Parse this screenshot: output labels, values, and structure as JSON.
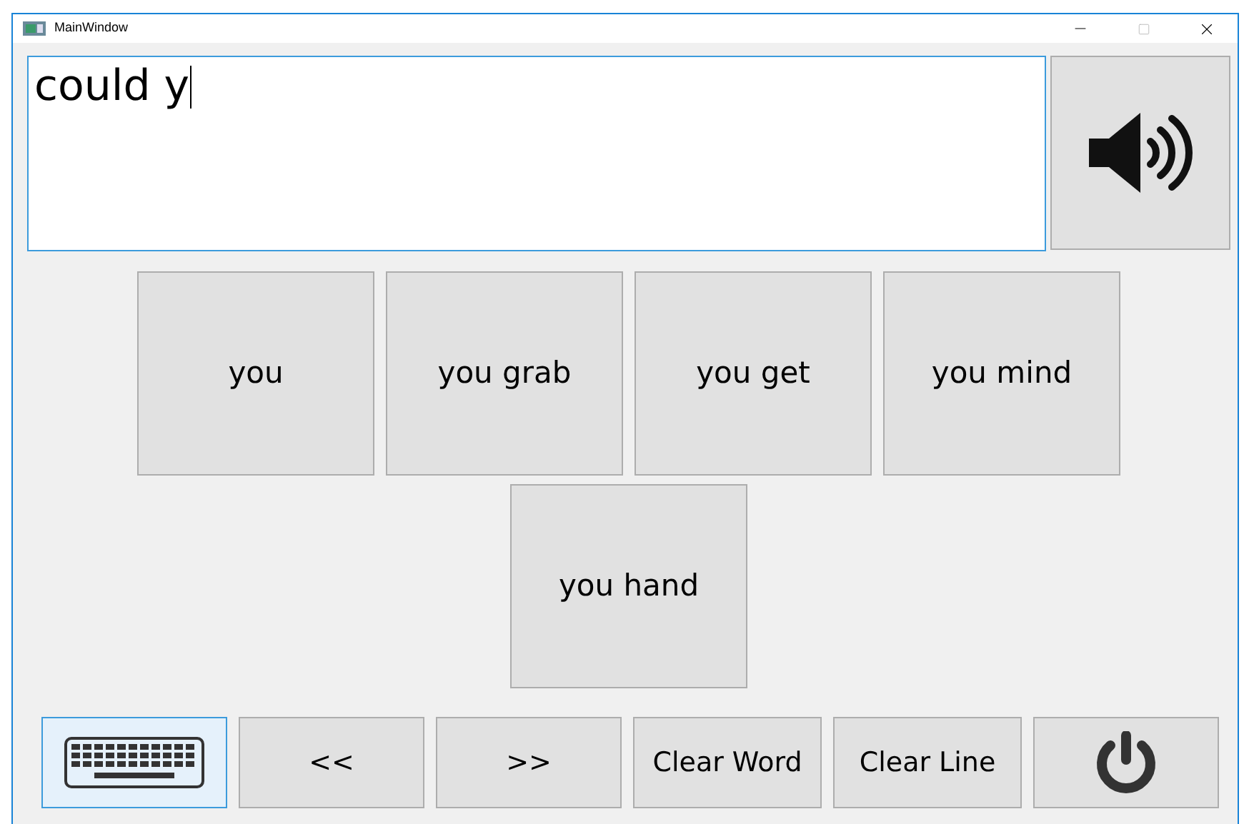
{
  "window": {
    "title": "MainWindow"
  },
  "text_box": {
    "value": "could y"
  },
  "suggestions": [
    {
      "label": "you"
    },
    {
      "label": "you grab"
    },
    {
      "label": "you get"
    },
    {
      "label": "you mind"
    },
    {
      "label": "you hand"
    }
  ],
  "toolbar": [
    {
      "kind": "keyboard",
      "focused": true
    },
    {
      "kind": "text",
      "label": "<<",
      "focused": false
    },
    {
      "kind": "text",
      "label": ">>",
      "focused": false
    },
    {
      "kind": "text",
      "label": "Clear Word",
      "focused": false
    },
    {
      "kind": "text",
      "label": "Clear Line",
      "focused": false
    },
    {
      "kind": "power",
      "focused": false
    }
  ]
}
